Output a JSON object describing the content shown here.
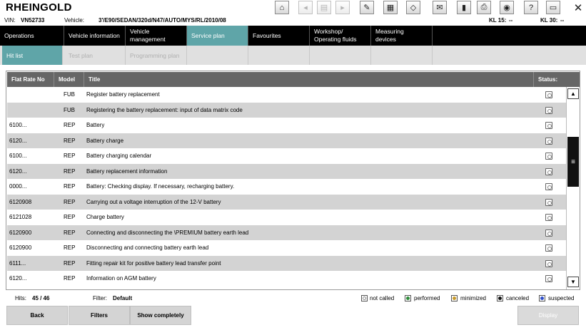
{
  "app": {
    "title": "RHEINGOLD"
  },
  "toolbar": {
    "icons": [
      "home-icon",
      "back-arrow-icon",
      "clipboard-icon",
      "forward-arrow-icon",
      "wrench-icon",
      "calculator-icon",
      "tag-icon",
      "mail-icon",
      "battery-icon",
      "printer-icon",
      "help-icon",
      "measure-icon",
      "close-icon"
    ],
    "close": "✕"
  },
  "vehicle": {
    "vin_label": "VIN:",
    "vin": "VN52733",
    "vehicle_label": "Vehicle:",
    "vehicle": "3'/E90/SEDAN/320d/N47/AUTO/MYS/RL/2010/08",
    "kl15_label": "KL 15:",
    "kl15": "--",
    "kl30_label": "KL 30:",
    "kl30": "--"
  },
  "main_tabs": [
    {
      "label": "Operations",
      "active": false
    },
    {
      "label": "Vehicle information",
      "active": false
    },
    {
      "label": "Vehicle management",
      "active": false
    },
    {
      "label": "Service plan",
      "active": true
    },
    {
      "label": "Favourites",
      "active": false
    },
    {
      "label": "Workshop/ Operating fluids",
      "active": false
    },
    {
      "label": "Measuring devices",
      "active": false
    }
  ],
  "sub_tabs": [
    {
      "label": "Hit list",
      "active": true
    },
    {
      "label": "Test plan",
      "active": false
    },
    {
      "label": "Programming plan",
      "active": false
    }
  ],
  "table": {
    "columns": [
      "Flat Rate No",
      "Model",
      "Title",
      "Status:"
    ],
    "rows": [
      {
        "flat_rate": "",
        "model": "FUB",
        "title": "Register battery replacement"
      },
      {
        "flat_rate": "",
        "model": "FUB",
        "title": "Registering the battery replacement: input of data matrix code"
      },
      {
        "flat_rate": "6100...",
        "model": "REP",
        "title": "Battery"
      },
      {
        "flat_rate": "6120...",
        "model": "REP",
        "title": "Battery charge"
      },
      {
        "flat_rate": "6100...",
        "model": "REP",
        "title": "Battery charging calendar"
      },
      {
        "flat_rate": "6120...",
        "model": "REP",
        "title": "Battery replacement information"
      },
      {
        "flat_rate": "0000...",
        "model": "REP",
        "title": "Battery: Checking display. If necessary, recharging battery."
      },
      {
        "flat_rate": "6120908",
        "model": "REP",
        "title": "Carrying out a voltage interruption of the 12-V battery"
      },
      {
        "flat_rate": "6121028",
        "model": "REP",
        "title": "Charge battery"
      },
      {
        "flat_rate": "6120900",
        "model": "REP",
        "title": "Connecting and disconnecting the \\PREMIUM battery earth lead"
      },
      {
        "flat_rate": "6120900",
        "model": "REP",
        "title": "Disconnecting and connecting battery earth lead"
      },
      {
        "flat_rate": "6111...",
        "model": "REP",
        "title": "Fitting repair kit for positive battery lead transfer point"
      },
      {
        "flat_rate": "6120...",
        "model": "REP",
        "title": "Information on AGM battery"
      }
    ]
  },
  "footer": {
    "hits_label": "Hits:",
    "hits": "45 / 46",
    "filter_label": "Filter:",
    "filter": "Default",
    "legend": [
      {
        "label": "not called",
        "icon": "status-not-called-icon"
      },
      {
        "label": "performed",
        "icon": "status-performed-icon",
        "color": "#2e8b3a"
      },
      {
        "label": "minimized",
        "icon": "status-minimized-icon",
        "color": "#c89a2b"
      },
      {
        "label": "canceled",
        "icon": "status-canceled-icon",
        "color": "#111111"
      },
      {
        "label": "suspected",
        "icon": "status-suspected-icon",
        "color": "#2f4fc9"
      }
    ]
  },
  "buttons": {
    "back": "Back",
    "filters": "Filters",
    "show_completely": "Show completely",
    "display": "Display"
  },
  "colors": {
    "accent": "#5fa5a8",
    "header_bg": "#000000",
    "table_header": "#666666",
    "row_alt": "#d3d3d3"
  }
}
